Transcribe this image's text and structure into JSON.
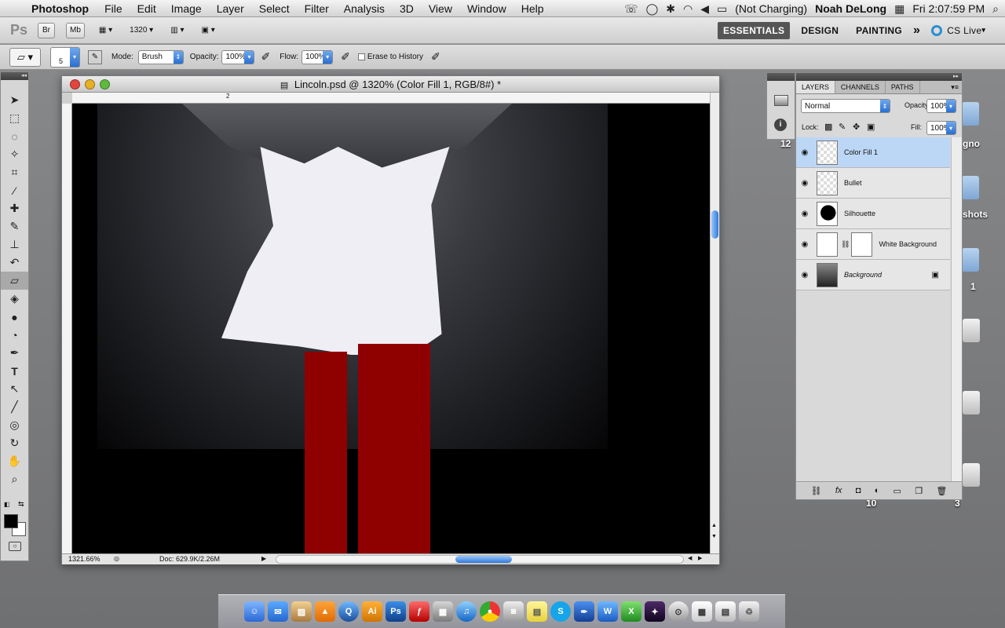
{
  "menubar": {
    "app_name": "Photoshop",
    "items": [
      "File",
      "Edit",
      "Image",
      "Layer",
      "Select",
      "Filter",
      "Analysis",
      "3D",
      "View",
      "Window",
      "Help"
    ],
    "battery": "(Not Charging)",
    "user": "Noah DeLong",
    "clock": "Fri 2:07:59 PM"
  },
  "appbar": {
    "logo": "Ps",
    "bridge": "Br",
    "minibridge": "Mb",
    "zoom": "1320",
    "workspaces": [
      "ESSENTIALS",
      "DESIGN",
      "PAINTING"
    ],
    "more": "»",
    "cs_live": "CS Live"
  },
  "options": {
    "brush_size": "5",
    "mode_label": "Mode:",
    "mode_value": "Brush",
    "opacity_label": "Opacity:",
    "opacity_value": "100%",
    "flow_label": "Flow:",
    "flow_value": "100%",
    "erase_history": "Erase to History"
  },
  "document": {
    "title": "Lincoln.psd @ 1320% (Color Fill 1, RGB/8#) *",
    "ruler_mark": "2",
    "zoom_status": "1321.66%",
    "doc_size": "Doc: 629.9K/2.26M"
  },
  "layers_panel": {
    "tabs": [
      "LAYERS",
      "CHANNELS",
      "PATHS"
    ],
    "blend_mode": "Normal",
    "opacity_label": "Opacity:",
    "opacity_value": "100%",
    "lock_label": "Lock:",
    "fill_label": "Fill:",
    "fill_value": "100%",
    "layers": [
      {
        "name": "Color Fill 1"
      },
      {
        "name": "Bullet"
      },
      {
        "name": "Silhouette"
      },
      {
        "name": "White Background"
      },
      {
        "name": "Background"
      }
    ]
  },
  "desktop": {
    "labels": [
      "12",
      "gno",
      "shots",
      "1",
      "10",
      "3"
    ]
  },
  "colors": {
    "canvas_red": "#8f0000",
    "selected_layer": "#bcd6f6",
    "accent_blue": "#2a6fd1"
  }
}
